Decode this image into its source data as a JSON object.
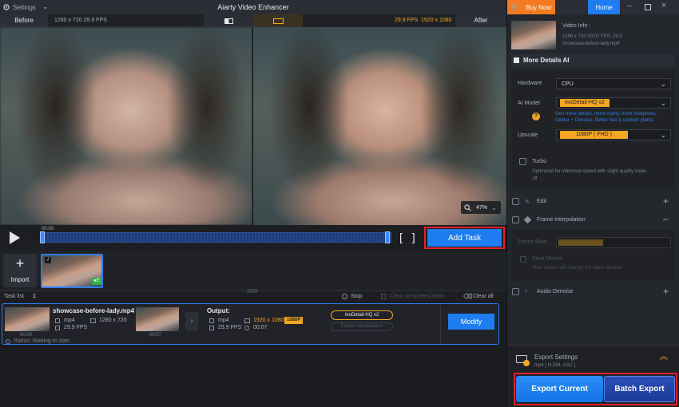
{
  "app": {
    "title": "Aiarty Video Enhancer",
    "settings_label": "Settings",
    "buy_label": "Buy Now",
    "home_label": "Home"
  },
  "preview": {
    "before_label": "Before",
    "before_info": "1280 x 720  29.9 FPS",
    "after_fps": "29.9 FPS",
    "after_res": "1920 x 1080",
    "after_label": "After",
    "zoom": "47%",
    "time": "00:00"
  },
  "controls": {
    "add_task": "Add Task",
    "import": "Import"
  },
  "tasks": {
    "header_label": "Task list",
    "count": "1",
    "stop": "Stop",
    "clear_completed": "Clear completed tasks",
    "clear_all": "Clear all",
    "item": {
      "filename": "showcase-before-lady.mp4",
      "format": "mp4",
      "resolution": "1280 x 720",
      "fps": "29.9 FPS",
      "thumb_time_start": "00:00",
      "thumb_time_end": "00:07",
      "output_label": "Output:",
      "out_format": "mp4",
      "out_res": "1920 x 1080",
      "out_badge": "1080P",
      "out_fps": "29.9 FPS",
      "out_duration": "00:07",
      "model_tag": "moDetail-HQ  v2",
      "interp_tag": "Frame Interpolation",
      "modify": "Modify",
      "status": "Status: Waiting to start"
    }
  },
  "video_info": {
    "title": "Video Info :",
    "line1": "1280 x 720  00:07  FPS: 29.9",
    "line2": "showcase-before-lady.mp4"
  },
  "ai_section": {
    "title": "More Details AI",
    "hardware_label": "Hardware",
    "hardware_value": "CPU",
    "model_label": "AI Model",
    "model_value": "moDetail-HQ  v2",
    "model_desc": "Gen more details, more clarity, more sharpness. Deblur + Denoise. Better hair & outdoor plants.",
    "upscale_label": "Upscale",
    "upscale_value": "1080P ( FHD )",
    "turbo_label": "Turbo",
    "turbo_desc": "Optimized for inference speed with slight quality trade-off"
  },
  "sections": {
    "edit": "Edit",
    "frame_interp": "Frame Interpolation",
    "frame_rate": "Frame Rate",
    "slow_motion": "Slow Motion",
    "slow_desc": "Slow motion will change the video duration",
    "audio_denoise": "Audio Denoise"
  },
  "export": {
    "title": "Export Settings",
    "sub": "mp4 [ H.264, AAC ]",
    "export_current": "Export Current",
    "batch_export": "Batch Export"
  },
  "colors": {
    "accent": "#1e7df0",
    "highlight": "#e8202a",
    "orange": "#f5a623"
  }
}
